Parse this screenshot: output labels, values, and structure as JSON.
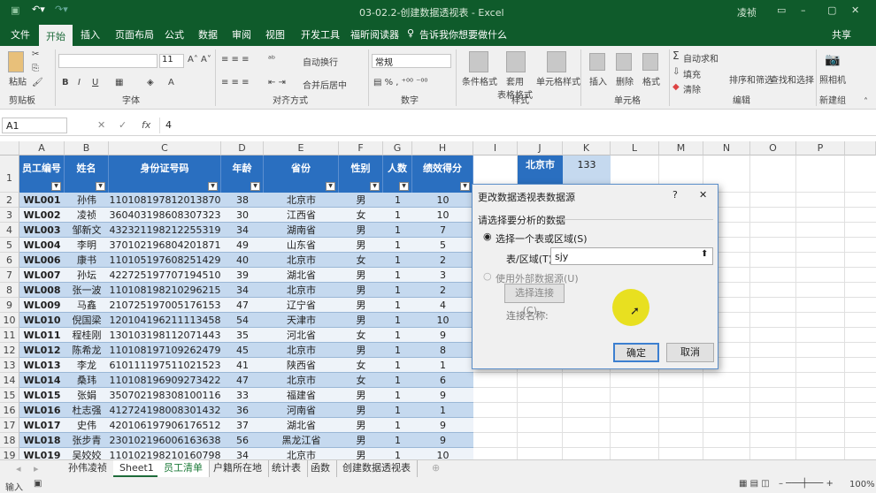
{
  "titlebar": {
    "title": "03-02.2-创建数据透视表 - Excel",
    "user": "凌祯",
    "share": "共享"
  },
  "ribbon_tabs": [
    "文件",
    "开始",
    "插入",
    "页面布局",
    "公式",
    "数据",
    "审阅",
    "视图",
    "开发工具",
    "福昕阅读器"
  ],
  "tell_me": "告诉我你想要做什么",
  "ribbon": {
    "paste": "粘贴",
    "clipboard": "剪贴板",
    "font_size": "11",
    "font": "字体",
    "wrap": "自动换行",
    "merge": "合并后居中",
    "alignment": "对齐方式",
    "number_format": "常规",
    "number": "数字",
    "cond_format": "条件格式",
    "table_format": "套用\n表格格式",
    "cell_style": "单元格样式",
    "styles": "样式",
    "insert": "插入",
    "delete": "删除",
    "format": "格式",
    "cells": "单元格",
    "autosum": "自动求和",
    "fill": "填充",
    "clear": "清除",
    "sort": "排序和筛选",
    "find": "查找和选择",
    "editing": "编辑",
    "camera": "照相机",
    "new_group": "新建组"
  },
  "formula_bar": {
    "name_box": "A1",
    "fx": "fx",
    "value": "4"
  },
  "columns": [
    "A",
    "B",
    "C",
    "D",
    "E",
    "F",
    "G",
    "H",
    "I",
    "J",
    "K",
    "L",
    "M",
    "N",
    "O",
    "P"
  ],
  "headers": [
    "员工编号",
    "姓名",
    "身份证号码",
    "年龄",
    "省份",
    "性别",
    "人数",
    "绩效得分"
  ],
  "rows": [
    [
      "WL001",
      "孙伟",
      "110108197812013870",
      "38",
      "北京市",
      "男",
      "1",
      "10"
    ],
    [
      "WL002",
      "凌祯",
      "360403198608307323",
      "30",
      "江西省",
      "女",
      "1",
      "10"
    ],
    [
      "WL003",
      "邹新文",
      "432321198212255319",
      "34",
      "湖南省",
      "男",
      "1",
      "7"
    ],
    [
      "WL004",
      "李明",
      "370102196804201871",
      "49",
      "山东省",
      "男",
      "1",
      "5"
    ],
    [
      "WL006",
      "康书",
      "110105197608251429",
      "40",
      "北京市",
      "女",
      "1",
      "2"
    ],
    [
      "WL007",
      "孙坛",
      "422725197707194510",
      "39",
      "湖北省",
      "男",
      "1",
      "3"
    ],
    [
      "WL008",
      "张一波",
      "110108198210296215",
      "34",
      "北京市",
      "男",
      "1",
      "2"
    ],
    [
      "WL009",
      "马鑫",
      "210725197005176153",
      "47",
      "辽宁省",
      "男",
      "1",
      "4"
    ],
    [
      "WL010",
      "倪国梁",
      "120104196211113458",
      "54",
      "天津市",
      "男",
      "1",
      "10"
    ],
    [
      "WL011",
      "程桂刚",
      "130103198112071443",
      "35",
      "河北省",
      "女",
      "1",
      "9"
    ],
    [
      "WL012",
      "陈希龙",
      "110108197109262479",
      "45",
      "北京市",
      "男",
      "1",
      "8"
    ],
    [
      "WL013",
      "李龙",
      "610111197511021523",
      "41",
      "陕西省",
      "女",
      "1",
      "1"
    ],
    [
      "WL014",
      "桑玮",
      "110108196909273422",
      "47",
      "北京市",
      "女",
      "1",
      "6"
    ],
    [
      "WL015",
      "张娟",
      "350702198308100116",
      "33",
      "福建省",
      "男",
      "1",
      "9"
    ],
    [
      "WL016",
      "杜志强",
      "412724198008301432",
      "36",
      "河南省",
      "男",
      "1",
      "1"
    ],
    [
      "WL017",
      "史伟",
      "420106197906176512",
      "37",
      "湖北省",
      "男",
      "1",
      "9"
    ],
    [
      "WL018",
      "张步青",
      "230102196006163638",
      "56",
      "黑龙江省",
      "男",
      "1",
      "9"
    ],
    [
      "WL019",
      "吴姣姣",
      "110102198210160798",
      "34",
      "北京市",
      "男",
      "1",
      "10"
    ]
  ],
  "side": {
    "j1": "北京市",
    "k1": "133"
  },
  "sheet_tabs": [
    "孙伟凌祯",
    "Sheet1",
    "员工清单",
    "户籍所在地",
    "统计表",
    "函数",
    "创建数据透视表"
  ],
  "status": {
    "mode": "输入",
    "zoom": "100%"
  },
  "dialog": {
    "title": "更改数据透视表数据源",
    "help": "?",
    "close": "✕",
    "section": "请选择要分析的数据",
    "opt1": "选择一个表或区域(S)",
    "range_label": "表/区域(T):",
    "range_value": "sjy",
    "opt2": "使用外部数据源(U)",
    "choose_conn": "选择连接(C)...",
    "conn_name": "连接名称:",
    "ok": "确定",
    "cancel": "取消"
  },
  "colors": {
    "excel_green": "#0f5b2b",
    "header_blue": "#2a6fc0",
    "band": "#c5d9ef"
  }
}
